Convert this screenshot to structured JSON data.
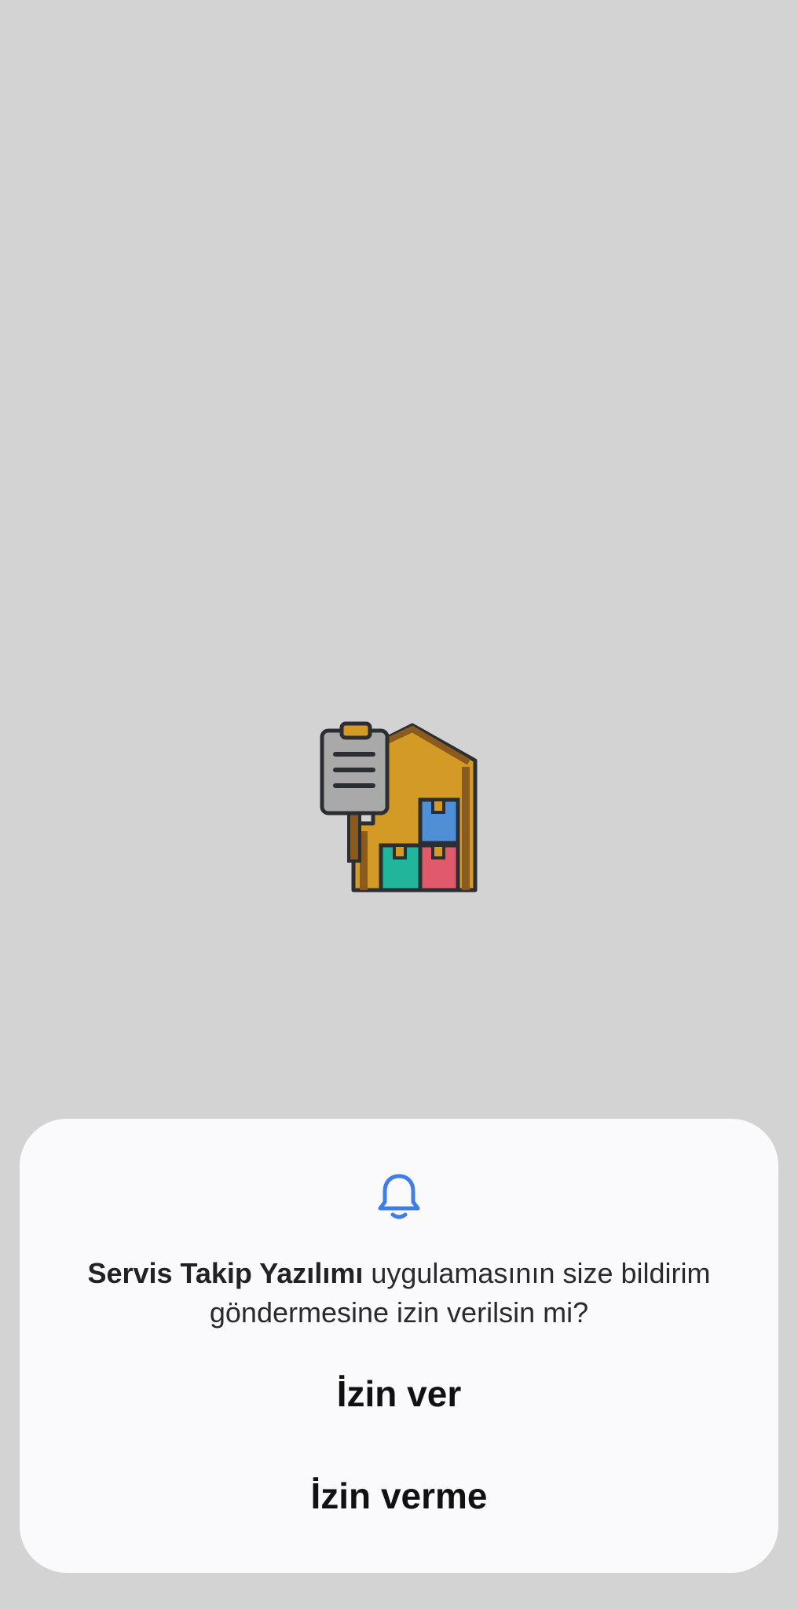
{
  "logo": {
    "icon": "warehouse-clipboard-icon",
    "colors": {
      "house": "#d39b26",
      "clipboard": "#a9a9a9",
      "box_blue": "#4f8fd6",
      "box_teal": "#21b59b",
      "box_red": "#e05a6b",
      "outline": "#2b2f33"
    }
  },
  "dialog": {
    "icon": "bell-icon",
    "accent": "#3f7ee6",
    "app_name": "Servis Takip Yazılımı",
    "message_line1_rest": " uygulamasının size bildirim",
    "message_line2": "göndermesine izin verilsin mi?",
    "allow_label": "İzin ver",
    "deny_label": "İzin verme"
  }
}
